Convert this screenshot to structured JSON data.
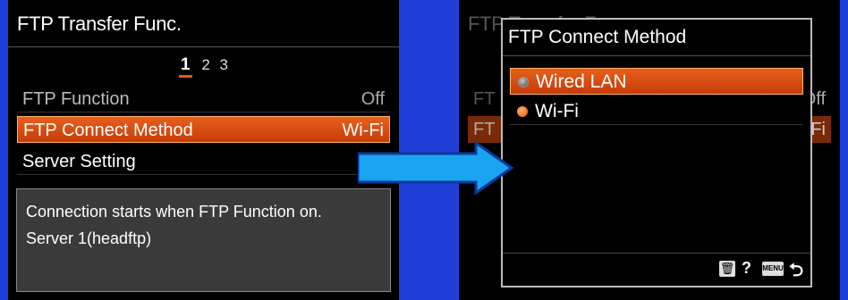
{
  "left": {
    "title": "FTP Transfer Func.",
    "pages": [
      "1",
      "2",
      "3"
    ],
    "rows": [
      {
        "label": "FTP Function",
        "value": "Off"
      },
      {
        "label": "FTP Connect Method",
        "value": "Wi-Fi"
      },
      {
        "label": "Server Setting",
        "value": ""
      }
    ],
    "description": [
      "Connection starts when FTP Function on.",
      "Server 1(headftp)"
    ]
  },
  "right": {
    "bg_title": "FTP Transfer Func.",
    "bg_off": "Off",
    "bg_wifi": "i-Fi",
    "popup": {
      "title": "FTP Connect Method",
      "options": [
        "Wired LAN",
        "Wi-Fi"
      ],
      "help": "?",
      "menu": "MENU"
    }
  },
  "colors": {
    "accent": "#e8581a",
    "background": "#1f3fd8",
    "arrow": "#1aa3f0"
  },
  "icons": [
    "trash-icon",
    "help-icon",
    "menu-icon",
    "back-icon",
    "right-arrow-icon"
  ]
}
